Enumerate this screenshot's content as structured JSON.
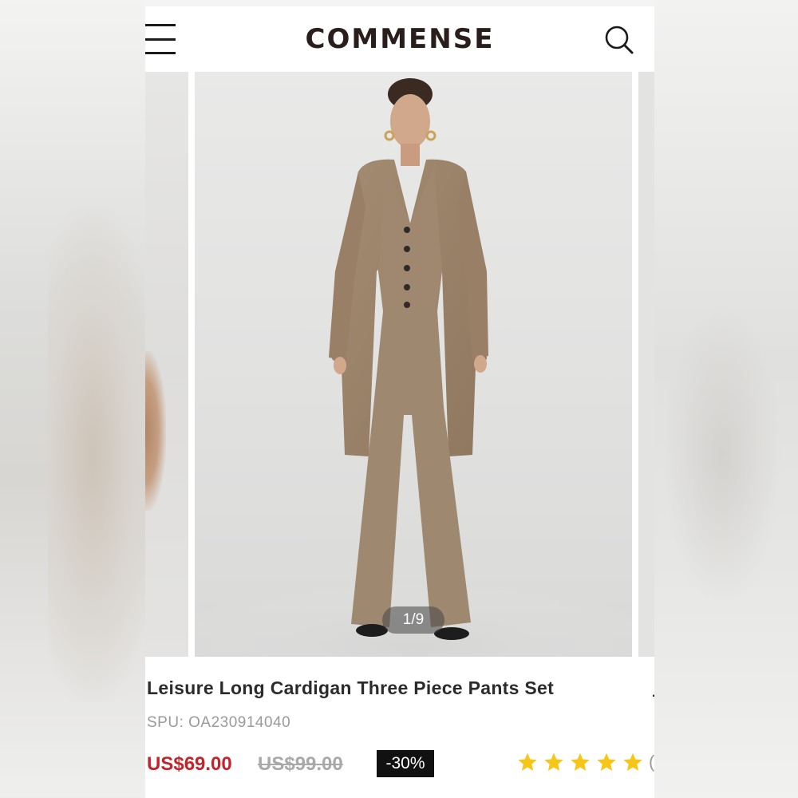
{
  "brand": {
    "logo_text": "COMMENSE"
  },
  "header": {
    "menu_icon": "hamburger-icon",
    "search_icon": "search-icon"
  },
  "carousel": {
    "pager_text": "1/9",
    "current_index": 1,
    "total": 9
  },
  "product": {
    "title": "Leisure Long Cardigan Three Piece Pants Set",
    "spu": "SPU: OA230914040",
    "price_sale": "US$69.00",
    "price_original": "US$99.00",
    "discount": "-30%",
    "rating_stars": 5,
    "rating_count_partial": "(",
    "next_title_partial": "."
  },
  "colors": {
    "sale_price": "#c4232b",
    "star": "#f5c518",
    "badge_bg": "#111111",
    "garment": "#9c8469"
  }
}
